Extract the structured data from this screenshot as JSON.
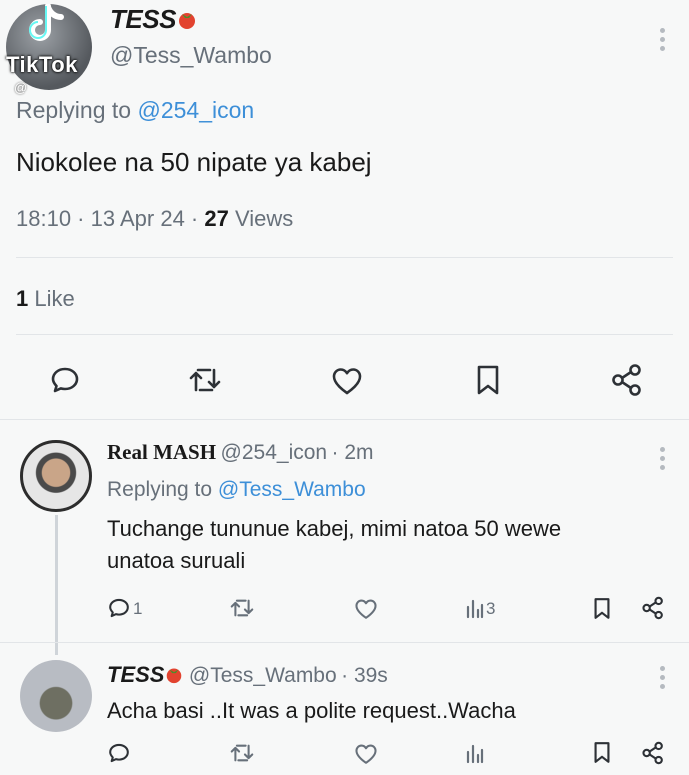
{
  "watermark": {
    "app": "TikTok",
    "sub": "@"
  },
  "tweet": {
    "name": "TESS",
    "name_emoji": "tomato-emoji",
    "handle": "@Tess_Wambo",
    "replying_prefix": "Replying to",
    "replying_to": "@254_icon",
    "text": "Niokolee na 50 nipate ya kabej",
    "time": "18:10",
    "date": "13 Apr 24",
    "views_count": "27",
    "views_label": "Views",
    "likes_count": "1",
    "likes_label": "Like",
    "actions": [
      "reply-icon",
      "retweet-icon",
      "like-icon",
      "bookmark-icon",
      "share-icon"
    ]
  },
  "replies": [
    {
      "name": "Real MASH",
      "handle": "@254_icon",
      "time": "· 2m",
      "replying_prefix": "Replying to",
      "replying_to": "@Tess_Wambo",
      "text_line1": "Tuchange tununue kabej, mimi natoa 50 wewe",
      "text_line2": "unatoa suruali",
      "reply_count": "1",
      "views_count": "3"
    },
    {
      "name": "TESS",
      "handle": "@Tess_Wambo",
      "time": "· 39s",
      "text": "Acha basi ..It was a polite request..Wacha"
    }
  ],
  "colors": {
    "link": "#3d8fd8",
    "muted": "#67707a",
    "tomato": "#e2432f"
  }
}
